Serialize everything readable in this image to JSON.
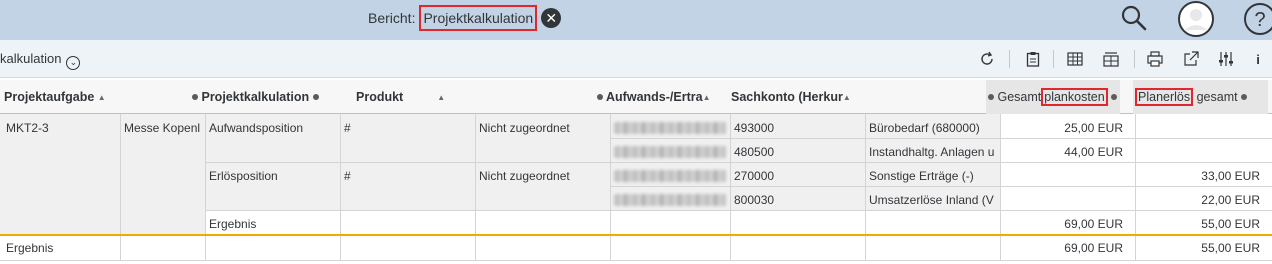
{
  "header": {
    "title_prefix": "Bericht:",
    "report_name": "Projektkalkulation",
    "icons": [
      "close-icon",
      "search-icon",
      "avatar",
      "help-icon"
    ]
  },
  "toolbar": {
    "report_name": "kalkulation",
    "icons": [
      "chevron-down-icon",
      "refresh-icon",
      "clipboard-icon",
      "table-icon",
      "table-settings-icon",
      "print-icon",
      "export-icon",
      "settings-icon",
      "info-icon"
    ]
  },
  "columns": {
    "projektaufgabe": "Projektaufgabe",
    "projektkalkulation": "Projektkalkulation",
    "produkt": "Produkt",
    "aufwands": "Aufwands-/Ertra",
    "sachkonto": "Sachkonto (Herkur",
    "gesamtplan_pre": "Gesamt",
    "gesamtplan_hl": "plankosten",
    "planerloes_hl": "Planerlös",
    "planerloes_post": "gesamt"
  },
  "rows": {
    "task": "MKT2-3",
    "messe": "Messe Kopenl",
    "aufwand": "Aufwandsposition",
    "erloes": "Erlösposition",
    "ergebnis_sub": "Ergebnis",
    "hash1": "#",
    "hash2": "#",
    "nz1": "Nicht zugeordnet",
    "nz2": "Nicht zugeordnet",
    "acct1": "493000",
    "acct2": "480500",
    "acct3": "270000",
    "acct4": "800030",
    "acctname1": "Bürobedarf (680000)",
    "acctname2": "Instandhaltg. Anlagen u",
    "acctname3": "Sonstige Erträge (-)",
    "acctname4": "Umsatzerlöse Inland (V",
    "k1": "25,00 EUR",
    "k2": "44,00 EUR",
    "e3": "33,00 EUR",
    "e4": "22,00 EUR",
    "sub_k": "69,00 EUR",
    "sub_e": "55,00 EUR",
    "total_label": "Ergebnis",
    "total_k": "69,00 EUR",
    "total_e": "55,00 EUR"
  },
  "colors": {
    "shell": "#c2d3e5",
    "toolbar": "#eef3f8",
    "highlight": "#e2262d",
    "result_line": "#f0ab00",
    "grey_cell": "#efefef"
  }
}
